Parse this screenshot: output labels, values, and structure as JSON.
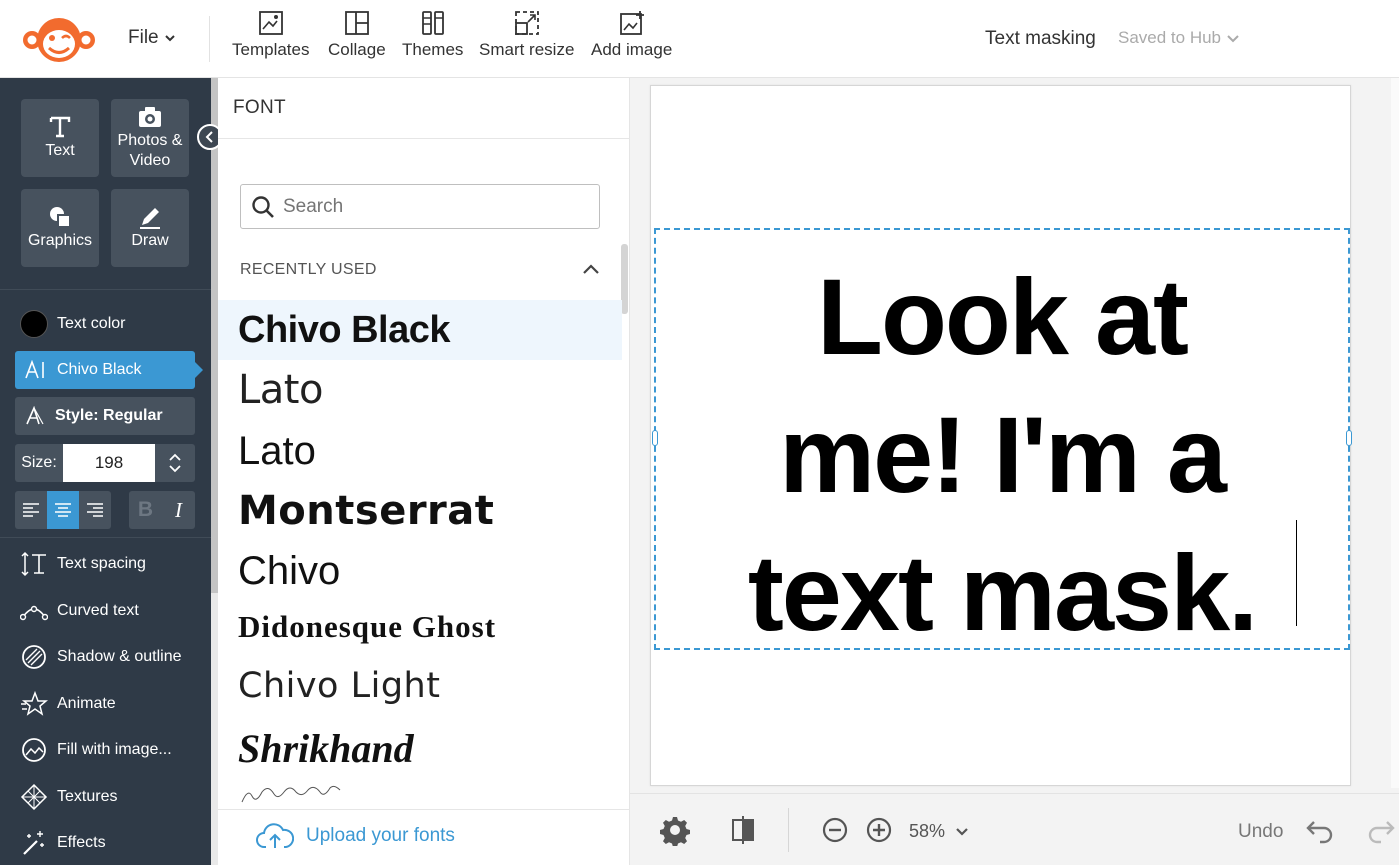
{
  "header": {
    "file_label": "File",
    "tools": [
      {
        "label": "Templates",
        "icon": "templates-icon"
      },
      {
        "label": "Collage",
        "icon": "collage-icon"
      },
      {
        "label": "Themes",
        "icon": "themes-icon"
      },
      {
        "label": "Smart resize",
        "icon": "smart-resize-icon"
      },
      {
        "label": "Add image",
        "icon": "add-image-icon"
      }
    ],
    "project_title": "Text masking",
    "save_status": "Saved to Hub"
  },
  "sidebar": {
    "tiles": [
      {
        "label": "Text",
        "icon": "text-icon"
      },
      {
        "label": "Photos & Video",
        "icon": "camera-icon"
      },
      {
        "label": "Graphics",
        "icon": "shapes-icon"
      },
      {
        "label": "Draw",
        "icon": "pencil-icon"
      }
    ],
    "text_color_label": "Text color",
    "text_color": "#000000",
    "font_button_label": "Chivo Black",
    "style_label": "Style: Regular",
    "size_label": "Size:",
    "size_value": "198",
    "bold_glyph": "B",
    "italic_glyph": "I",
    "menu": [
      {
        "label": "Text spacing",
        "icon": "text-spacing-icon"
      },
      {
        "label": "Curved text",
        "icon": "curved-text-icon"
      },
      {
        "label": "Shadow & outline",
        "icon": "shadow-outline-icon"
      },
      {
        "label": "Animate",
        "icon": "animate-star-icon"
      },
      {
        "label": "Fill with image...",
        "icon": "fill-image-icon"
      },
      {
        "label": "Textures",
        "icon": "textures-icon"
      },
      {
        "label": "Effects",
        "icon": "effects-wand-icon"
      }
    ]
  },
  "font_panel": {
    "heading": "FONT",
    "search_placeholder": "Search",
    "recently_used_label": "RECENTLY USED",
    "fonts": [
      "Chivo Black",
      "Lato",
      "Lato",
      "Montserrat",
      "Chivo",
      "Didonesque Ghost",
      "Chivo Light",
      "Shrikhand"
    ],
    "selected_font": "Chivo Black",
    "upload_label": "Upload your fonts"
  },
  "canvas": {
    "text_lines": [
      "Look at",
      "me! I'm a",
      "text mask."
    ]
  },
  "bottom_bar": {
    "zoom": "58%",
    "undo_label": "Undo"
  },
  "colors": {
    "accent": "#3b98d3",
    "sidebar_bg": "#2f3a47",
    "tile_bg": "#47525e",
    "logo_orange": "#f26b2e"
  }
}
